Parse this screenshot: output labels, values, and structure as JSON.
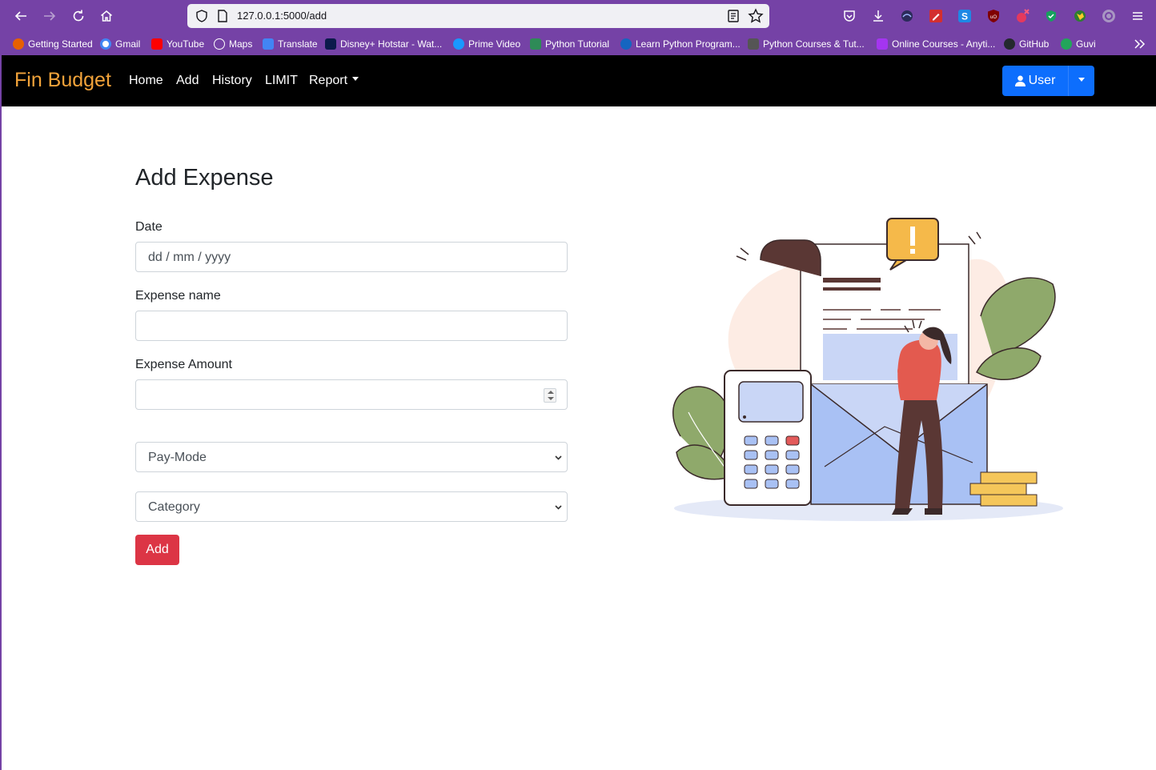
{
  "browser": {
    "url": "127.0.0.1:5000/add",
    "bookmarks": [
      {
        "label": "Getting Started",
        "color": "#e66000"
      },
      {
        "label": "Gmail",
        "color": "#ffffff"
      },
      {
        "label": "YouTube",
        "color": "#ff0000"
      },
      {
        "label": "Maps",
        "color": "#ffffff"
      },
      {
        "label": "Translate",
        "color": "#4285f4"
      },
      {
        "label": "Disney+ Hotstar - Wat...",
        "color": "#0c1a4b"
      },
      {
        "label": "Prime Video",
        "color": "#1a98ff"
      },
      {
        "label": "Python Tutorial",
        "color": "#2e8b57"
      },
      {
        "label": "Learn Python Program...",
        "color": "#1565c0"
      },
      {
        "label": "Python Courses & Tut...",
        "color": "#555555"
      },
      {
        "label": "Online Courses - Anyti...",
        "color": "#a435f0"
      },
      {
        "label": "GitHub",
        "color": "#24292e"
      },
      {
        "label": "Guvi",
        "color": "#22a55a"
      }
    ]
  },
  "navbar": {
    "brand": "Fin Budget",
    "links": [
      "Home",
      "Add",
      "History",
      "LIMIT",
      "Report"
    ],
    "user_label": "User"
  },
  "form": {
    "title": "Add Expense",
    "date_label": "Date",
    "date_placeholder": "dd / mm / yyyy",
    "name_label": "Expense name",
    "amount_label": "Expense Amount",
    "paymode_selected": "Pay-Mode",
    "category_selected": "Category",
    "submit_label": "Add"
  },
  "colors": {
    "browser_purple": "#7542a6",
    "brand_orange": "#f2a33a",
    "primary_blue": "#0d6efd",
    "danger_red": "#dc3545"
  }
}
